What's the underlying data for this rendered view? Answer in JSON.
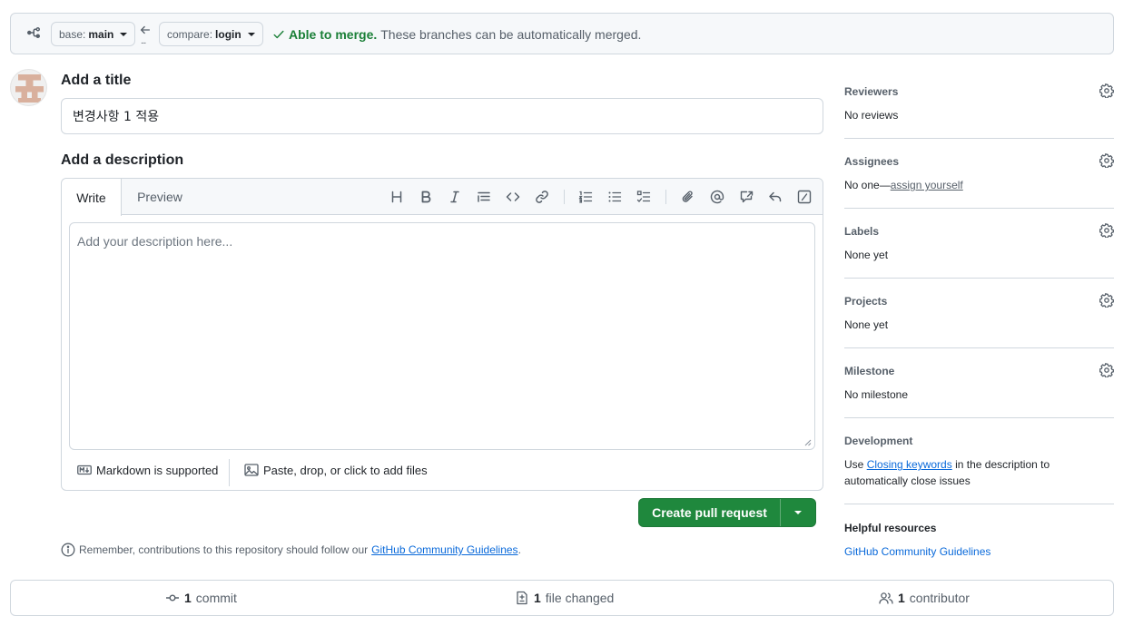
{
  "compare_bar": {
    "base_prefix": "base:",
    "base_branch": "main",
    "compare_prefix": "compare:",
    "compare_branch": "login",
    "dots": "...",
    "merge_ok": "Able to merge.",
    "merge_msg": "These branches can be automatically merged."
  },
  "form": {
    "title_heading": "Add a title",
    "title_value": "변경사항 1 적용",
    "description_heading": "Add a description",
    "tab_write": "Write",
    "tab_preview": "Preview",
    "description_placeholder": "Add your description here...",
    "markdown_note": "Markdown is supported",
    "attach_note": "Paste, drop, or click to add files",
    "toolbar_icons": [
      "heading-icon",
      "bold-icon",
      "italic-icon",
      "quote-icon",
      "code-icon",
      "link-icon",
      "numbered-list-icon",
      "unordered-list-icon",
      "task-list-icon",
      "attach-icon",
      "mention-icon",
      "reference-icon",
      "saved-reply-icon",
      "slash-command-icon"
    ]
  },
  "create_button": {
    "label": "Create pull request"
  },
  "remember": {
    "text": "Remember, contributions to this repository should follow our",
    "link": "GitHub Community Guidelines",
    "end": "."
  },
  "sidebar": {
    "reviewers": {
      "heading": "Reviewers",
      "value": "No reviews"
    },
    "assignees": {
      "heading": "Assignees",
      "value_prefix": "No one—",
      "link": "assign yourself"
    },
    "labels": {
      "heading": "Labels",
      "value": "None yet"
    },
    "projects": {
      "heading": "Projects",
      "value": "None yet"
    },
    "milestone": {
      "heading": "Milestone",
      "value": "No milestone"
    },
    "development": {
      "heading": "Development",
      "prefix": "Use",
      "link": "Closing keywords",
      "suffix": "in the description to",
      "line2": "automatically close issues"
    },
    "helpful": {
      "heading": "Helpful resources",
      "link": "GitHub Community Guidelines"
    }
  },
  "summary": {
    "commits_count": "1",
    "commits_label": "commit",
    "files_count": "1",
    "files_label": "file changed",
    "contributors_count": "1",
    "contributors_label": "contributor"
  },
  "colors": {
    "accent_green": "#1f883d",
    "link_blue": "#0969da",
    "ok_green": "#1a7f37",
    "border": "#d0d7de"
  }
}
